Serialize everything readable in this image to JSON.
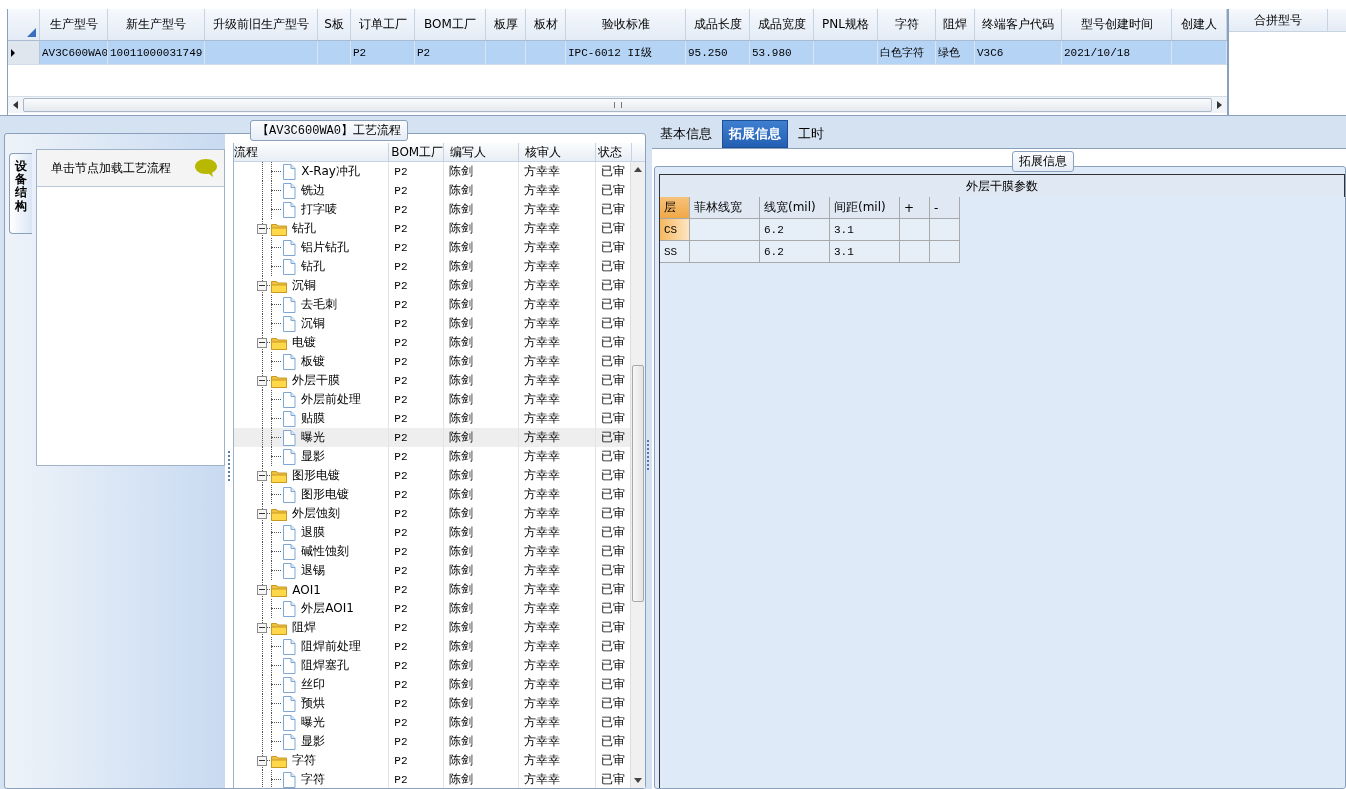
{
  "product_grid": {
    "columns": [
      "生产型号",
      "新生产型号",
      "升级前旧生产型号",
      "S板",
      "订单工厂",
      "BOM工厂",
      "板厚",
      "板材",
      "验收标准",
      "成品长度",
      "成品宽度",
      "PNL规格",
      "字符",
      "阻焊",
      "终端客户代码",
      "型号创建时间",
      "创建人"
    ],
    "rows": [
      {
        "selected": true,
        "cells": [
          "AV3C600WA0",
          "10011000031749",
          "",
          "",
          "P2",
          "P2",
          "",
          "",
          "IPC-6012 II级",
          "95.250",
          "53.980",
          "",
          "白色字符",
          "绿色",
          "V3C6",
          "2021/10/18",
          ""
        ]
      }
    ]
  },
  "merge_panel": {
    "columns": [
      "合拼型号"
    ]
  },
  "process_group": {
    "title": "【AV3C600WA0】工艺流程",
    "side_tab": "设备结构",
    "hint": "单击节点加载工艺流程",
    "tree_columns": [
      "流程",
      "BOM工厂",
      "编写人",
      "核审人",
      "状态"
    ],
    "tree": [
      {
        "children": [
          {
            "label": "X-Ray冲孔",
            "cells": [
              "P2",
              "陈剑",
              "方幸幸",
              "已审"
            ],
            "selected": false
          },
          {
            "label": "铣边",
            "cells": [
              "P2",
              "陈剑",
              "方幸幸",
              "已审"
            ],
            "selected": false
          },
          {
            "label": "打字唛",
            "cells": [
              "P2",
              "陈剑",
              "方幸幸",
              "已审"
            ],
            "selected": false
          }
        ]
      },
      {
        "label": "钻孔",
        "cells": [
          "P2",
          "陈剑",
          "方幸幸",
          "已审"
        ],
        "selected": false,
        "expanded": true,
        "children": [
          {
            "label": "铝片钻孔",
            "cells": [
              "P2",
              "陈剑",
              "方幸幸",
              "已审"
            ],
            "selected": false
          },
          {
            "label": "钻孔",
            "cells": [
              "P2",
              "陈剑",
              "方幸幸",
              "已审"
            ],
            "selected": false
          }
        ]
      },
      {
        "label": "沉铜",
        "cells": [
          "P2",
          "陈剑",
          "方幸幸",
          "已审"
        ],
        "selected": false,
        "expanded": true,
        "children": [
          {
            "label": "去毛刺",
            "cells": [
              "P2",
              "陈剑",
              "方幸幸",
              "已审"
            ],
            "selected": false
          },
          {
            "label": "沉铜",
            "cells": [
              "P2",
              "陈剑",
              "方幸幸",
              "已审"
            ],
            "selected": false
          }
        ]
      },
      {
        "label": "电镀",
        "cells": [
          "P2",
          "陈剑",
          "方幸幸",
          "已审"
        ],
        "selected": false,
        "expanded": true,
        "children": [
          {
            "label": "板镀",
            "cells": [
              "P2",
              "陈剑",
              "方幸幸",
              "已审"
            ],
            "selected": false
          }
        ]
      },
      {
        "label": "外层干膜",
        "cells": [
          "P2",
          "陈剑",
          "方幸幸",
          "已审"
        ],
        "selected": false,
        "expanded": true,
        "children": [
          {
            "label": "外层前处理",
            "cells": [
              "P2",
              "陈剑",
              "方幸幸",
              "已审"
            ],
            "selected": false
          },
          {
            "label": "贴膜",
            "cells": [
              "P2",
              "陈剑",
              "方幸幸",
              "已审"
            ],
            "selected": false
          },
          {
            "label": "曝光",
            "cells": [
              "P2",
              "陈剑",
              "方幸幸",
              "已审"
            ],
            "selected": true
          },
          {
            "label": "显影",
            "cells": [
              "P2",
              "陈剑",
              "方幸幸",
              "已审"
            ],
            "selected": false
          }
        ]
      },
      {
        "label": "图形电镀",
        "cells": [
          "P2",
          "陈剑",
          "方幸幸",
          "已审"
        ],
        "selected": false,
        "expanded": true,
        "children": [
          {
            "label": "图形电镀",
            "cells": [
              "P2",
              "陈剑",
              "方幸幸",
              "已审"
            ],
            "selected": false
          }
        ]
      },
      {
        "label": "外层蚀刻",
        "cells": [
          "P2",
          "陈剑",
          "方幸幸",
          "已审"
        ],
        "selected": false,
        "expanded": true,
        "children": [
          {
            "label": "退膜",
            "cells": [
              "P2",
              "陈剑",
              "方幸幸",
              "已审"
            ],
            "selected": false
          },
          {
            "label": "碱性蚀刻",
            "cells": [
              "P2",
              "陈剑",
              "方幸幸",
              "已审"
            ],
            "selected": false
          },
          {
            "label": "退锡",
            "cells": [
              "P2",
              "陈剑",
              "方幸幸",
              "已审"
            ],
            "selected": false
          }
        ]
      },
      {
        "label": "AOI1",
        "cells": [
          "P2",
          "陈剑",
          "方幸幸",
          "已审"
        ],
        "selected": false,
        "expanded": true,
        "children": [
          {
            "label": "外层AOI1",
            "cells": [
              "P2",
              "陈剑",
              "方幸幸",
              "已审"
            ],
            "selected": false
          }
        ]
      },
      {
        "label": "阻焊",
        "cells": [
          "P2",
          "陈剑",
          "方幸幸",
          "已审"
        ],
        "selected": false,
        "expanded": true,
        "children": [
          {
            "label": "阻焊前处理",
            "cells": [
              "P2",
              "陈剑",
              "方幸幸",
              "已审"
            ],
            "selected": false
          },
          {
            "label": "阻焊塞孔",
            "cells": [
              "P2",
              "陈剑",
              "方幸幸",
              "已审"
            ],
            "selected": false
          },
          {
            "label": "丝印",
            "cells": [
              "P2",
              "陈剑",
              "方幸幸",
              "已审"
            ],
            "selected": false
          },
          {
            "label": "预烘",
            "cells": [
              "P2",
              "陈剑",
              "方幸幸",
              "已审"
            ],
            "selected": false
          },
          {
            "label": "曝光",
            "cells": [
              "P2",
              "陈剑",
              "方幸幸",
              "已审"
            ],
            "selected": false
          },
          {
            "label": "显影",
            "cells": [
              "P2",
              "陈剑",
              "方幸幸",
              "已审"
            ],
            "selected": false
          }
        ]
      },
      {
        "label": "字符",
        "cells": [
          "P2",
          "陈剑",
          "方幸幸",
          "已审"
        ],
        "selected": false,
        "expanded": true,
        "children": [
          {
            "label": "字符",
            "cells": [
              "P2",
              "陈剑",
              "方幸幸",
              "已审"
            ],
            "selected": false
          }
        ]
      }
    ]
  },
  "detail": {
    "tabs": [
      {
        "label": "基本信息",
        "selected": false
      },
      {
        "label": "拓展信息",
        "selected": true
      },
      {
        "label": "工时",
        "selected": false
      }
    ],
    "group_title": "拓展信息",
    "table_title": "外层干膜参数",
    "columns": [
      "层",
      "菲林线宽",
      "线宽(mil)",
      "间距(mil)",
      "+",
      "-"
    ],
    "rows": [
      {
        "current": true,
        "cells": [
          "CS",
          "",
          "6.2",
          "3.1",
          "",
          ""
        ]
      },
      {
        "current": false,
        "cells": [
          "SS",
          "",
          "6.2",
          "3.1",
          "",
          ""
        ]
      }
    ]
  }
}
